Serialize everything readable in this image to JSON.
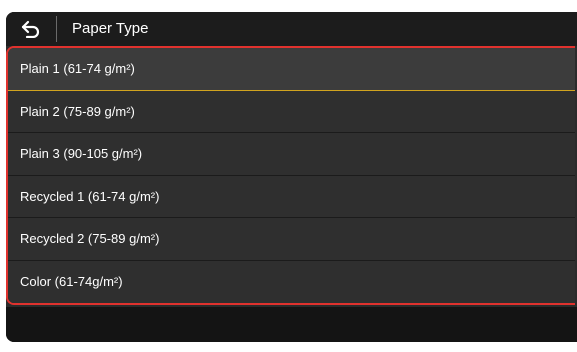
{
  "header": {
    "title": "Paper Type",
    "back_icon": "back-arrow-icon"
  },
  "paper_types": [
    {
      "label": "Plain 1 (61-74 g/m²)",
      "selected": true
    },
    {
      "label": "Plain 2 (75-89 g/m²)",
      "selected": false
    },
    {
      "label": "Plain 3 (90-105 g/m²)",
      "selected": false
    },
    {
      "label": "Recycled 1 (61-74 g/m²)",
      "selected": false
    },
    {
      "label": "Recycled 2 (75-89 g/m²)",
      "selected": false
    },
    {
      "label": "Color (61-74g/m²)",
      "selected": false
    }
  ],
  "colors": {
    "highlight_border": "#e0322e",
    "selection_line": "#d1a41f",
    "background": "#2b2b2b"
  }
}
